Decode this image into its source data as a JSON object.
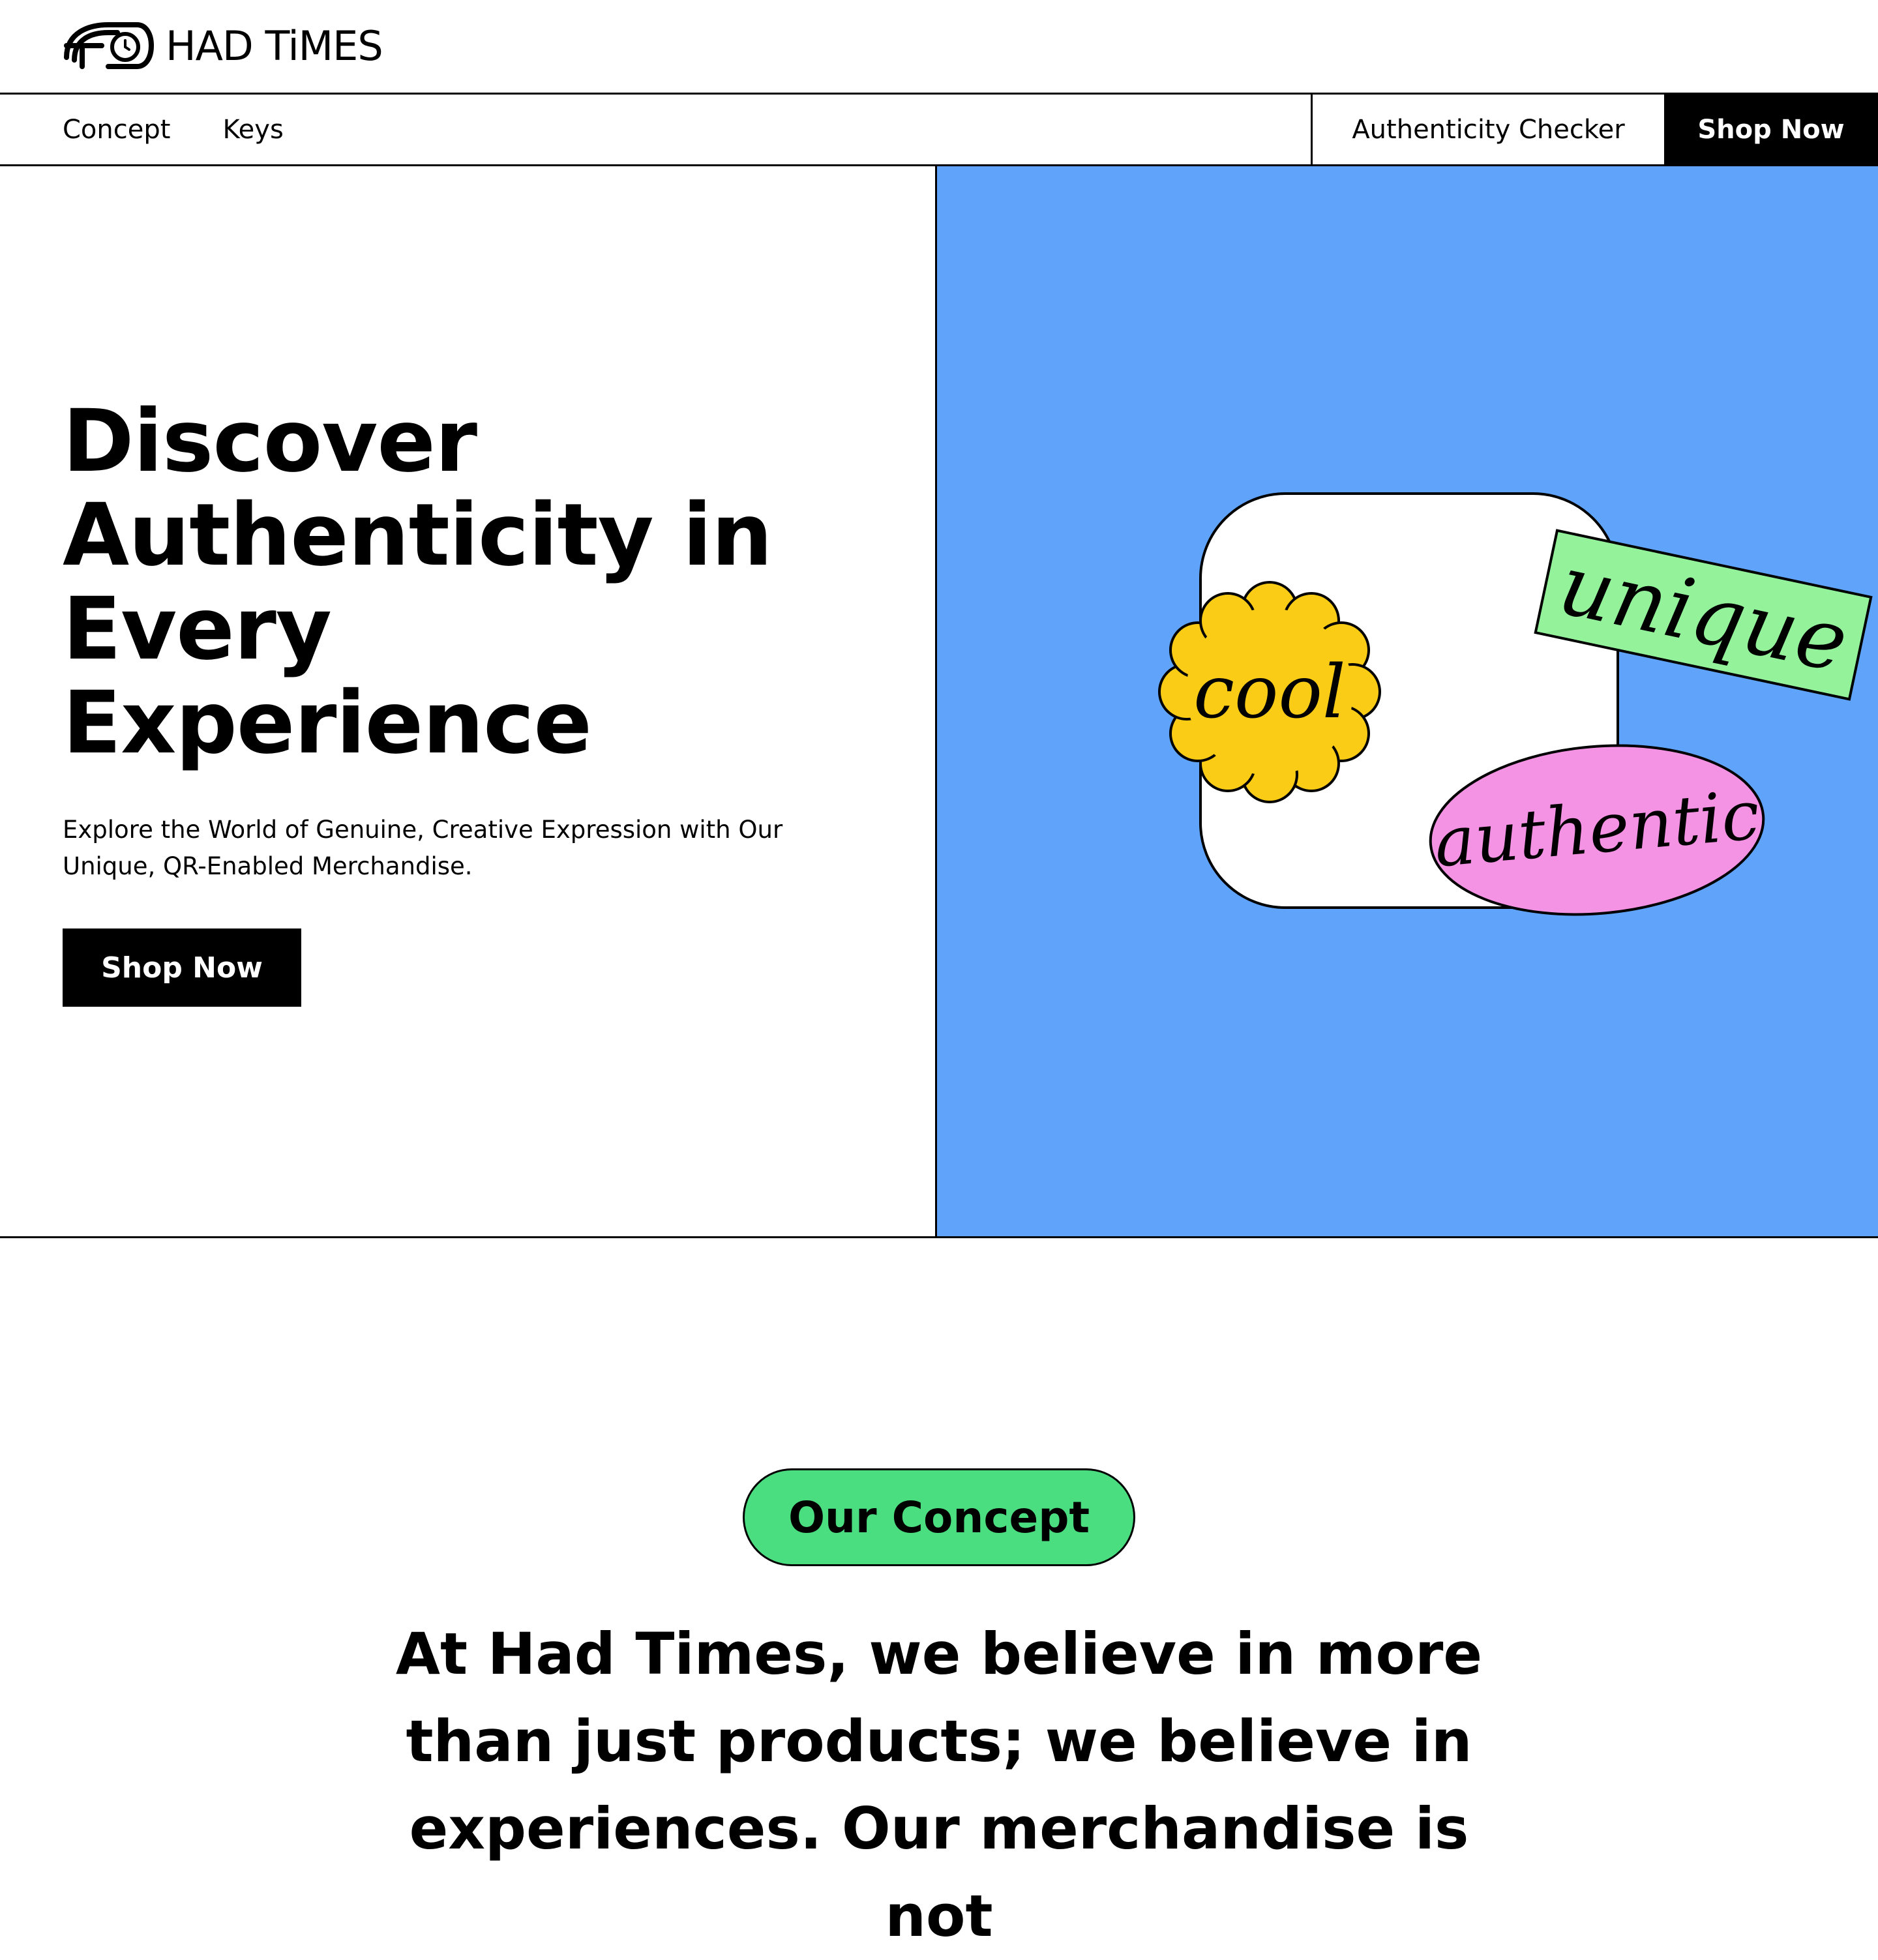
{
  "brand": {
    "name": "HAD TiMES"
  },
  "nav": {
    "links": [
      "Concept",
      "Keys"
    ],
    "checker_label": "Authenticity Checker",
    "shop_label": "Shop Now"
  },
  "hero": {
    "title": "Discover Authenticity in Every Experience",
    "subtitle": "Explore the World of Genuine, Creative Expression with Our Unique, QR-Enabled Merchandise.",
    "button_label": "Shop Now",
    "stickers": {
      "cool": "cool",
      "unique": "unique",
      "authentic": "authentic"
    }
  },
  "concept": {
    "pill_label": "Our Concept",
    "text": "At Had Times, we believe in more than just products; we believe in experiences. Our merchandise is not"
  },
  "colors": {
    "hero_bg": "#5fa4fa",
    "pill_green": "#4ade80",
    "sticker_yellow": "#facc15",
    "sticker_green": "#93f29a",
    "sticker_pink": "#f492e4",
    "black": "#000000",
    "white": "#ffffff"
  }
}
